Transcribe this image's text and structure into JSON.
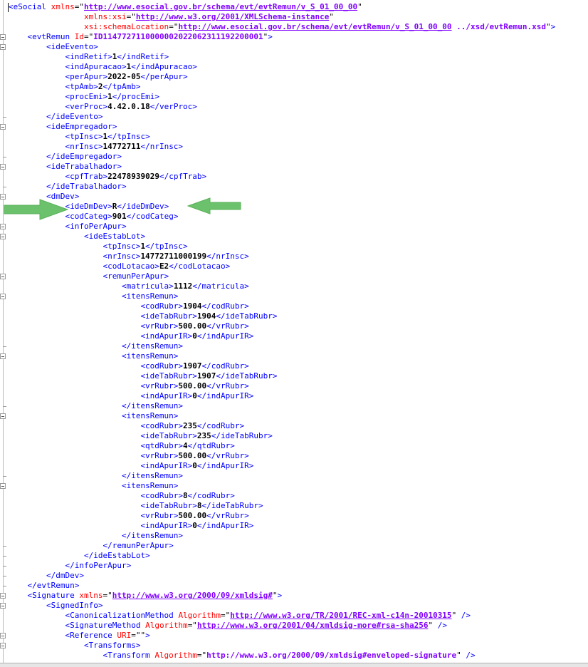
{
  "lines": [
    {
      "indent": 0,
      "parts": [
        [
          "tag",
          "<eSocial "
        ],
        [
          "attr",
          "xmlns"
        ],
        [
          "q",
          "=\""
        ],
        [
          "val",
          "http://www.esocial.gov.br/schema/evt/evtRemun/v_S_01_00_00"
        ],
        [
          "q",
          "\""
        ]
      ]
    },
    {
      "indent": 4,
      "parts": [
        [
          "attr",
          "xmlns:xsi"
        ],
        [
          "q",
          "=\""
        ],
        [
          "val",
          "http://www.w3.org/2001/XMLSchema-instance"
        ],
        [
          "q",
          "\""
        ]
      ]
    },
    {
      "indent": 4,
      "parts": [
        [
          "attr",
          "xsi:schemaLocation"
        ],
        [
          "q",
          "=\""
        ],
        [
          "val",
          "http://www.esocial.gov.br/schema/evt/evtRemun/v_S_01_00_00"
        ],
        [
          "valplain",
          " ../xsd/evtRemun.xsd"
        ],
        [
          "q",
          "\""
        ],
        [
          "tag",
          ">"
        ]
      ]
    },
    {
      "indent": 1,
      "parts": [
        [
          "tag",
          "<evtRemun "
        ],
        [
          "attr",
          "Id"
        ],
        [
          "q",
          "=\""
        ],
        [
          "valplain",
          "ID1147727110000002022062311192200001"
        ],
        [
          "q",
          "\""
        ],
        [
          "tag",
          ">"
        ]
      ]
    },
    {
      "indent": 2,
      "parts": [
        [
          "tag",
          "<ideEvento>"
        ]
      ]
    },
    {
      "indent": 3,
      "parts": [
        [
          "tag",
          "<indRetif>"
        ],
        [
          "txt",
          "1"
        ],
        [
          "tag",
          "</indRetif>"
        ]
      ]
    },
    {
      "indent": 3,
      "parts": [
        [
          "tag",
          "<indApuracao>"
        ],
        [
          "txt",
          "1"
        ],
        [
          "tag",
          "</indApuracao>"
        ]
      ]
    },
    {
      "indent": 3,
      "parts": [
        [
          "tag",
          "<perApur>"
        ],
        [
          "txt",
          "2022-05"
        ],
        [
          "tag",
          "</perApur>"
        ]
      ]
    },
    {
      "indent": 3,
      "parts": [
        [
          "tag",
          "<tpAmb>"
        ],
        [
          "txt",
          "2"
        ],
        [
          "tag",
          "</tpAmb>"
        ]
      ]
    },
    {
      "indent": 3,
      "parts": [
        [
          "tag",
          "<procEmi>"
        ],
        [
          "txt",
          "1"
        ],
        [
          "tag",
          "</procEmi>"
        ]
      ]
    },
    {
      "indent": 3,
      "parts": [
        [
          "tag",
          "<verProc>"
        ],
        [
          "txt",
          "4.42.0.18"
        ],
        [
          "tag",
          "</verProc>"
        ]
      ]
    },
    {
      "indent": 2,
      "parts": [
        [
          "tag",
          "</ideEvento>"
        ]
      ]
    },
    {
      "indent": 2,
      "parts": [
        [
          "tag",
          "<ideEmpregador>"
        ]
      ]
    },
    {
      "indent": 3,
      "parts": [
        [
          "tag",
          "<tpInsc>"
        ],
        [
          "txt",
          "1"
        ],
        [
          "tag",
          "</tpInsc>"
        ]
      ]
    },
    {
      "indent": 3,
      "parts": [
        [
          "tag",
          "<nrInsc>"
        ],
        [
          "txt",
          "14772711"
        ],
        [
          "tag",
          "</nrInsc>"
        ]
      ]
    },
    {
      "indent": 2,
      "parts": [
        [
          "tag",
          "</ideEmpregador>"
        ]
      ]
    },
    {
      "indent": 2,
      "parts": [
        [
          "tag",
          "<ideTrabalhador>"
        ]
      ]
    },
    {
      "indent": 3,
      "parts": [
        [
          "tag",
          "<cpfTrab>"
        ],
        [
          "txt",
          "22478939029"
        ],
        [
          "tag",
          "</cpfTrab>"
        ]
      ]
    },
    {
      "indent": 2,
      "parts": [
        [
          "tag",
          "</ideTrabalhador>"
        ]
      ]
    },
    {
      "indent": 2,
      "parts": [
        [
          "tag",
          "<dmDev>"
        ]
      ]
    },
    {
      "indent": 3,
      "parts": [
        [
          "tag",
          "<ideDmDev>"
        ],
        [
          "txt",
          "R"
        ],
        [
          "tag",
          "</ideDmDev>"
        ]
      ]
    },
    {
      "indent": 3,
      "parts": [
        [
          "tag",
          "<codCateg>"
        ],
        [
          "txt",
          "901"
        ],
        [
          "tag",
          "</codCateg>"
        ]
      ]
    },
    {
      "indent": 3,
      "parts": [
        [
          "tag",
          "<infoPerApur>"
        ]
      ]
    },
    {
      "indent": 4,
      "parts": [
        [
          "tag",
          "<ideEstabLot>"
        ]
      ]
    },
    {
      "indent": 5,
      "parts": [
        [
          "tag",
          "<tpInsc>"
        ],
        [
          "txt",
          "1"
        ],
        [
          "tag",
          "</tpInsc>"
        ]
      ]
    },
    {
      "indent": 5,
      "parts": [
        [
          "tag",
          "<nrInsc>"
        ],
        [
          "txt",
          "14772711000199"
        ],
        [
          "tag",
          "</nrInsc>"
        ]
      ]
    },
    {
      "indent": 5,
      "parts": [
        [
          "tag",
          "<codLotacao>"
        ],
        [
          "txt",
          "E2"
        ],
        [
          "tag",
          "</codLotacao>"
        ]
      ]
    },
    {
      "indent": 5,
      "parts": [
        [
          "tag",
          "<remunPerApur>"
        ]
      ]
    },
    {
      "indent": 6,
      "parts": [
        [
          "tag",
          "<matricula>"
        ],
        [
          "txt",
          "1112"
        ],
        [
          "tag",
          "</matricula>"
        ]
      ]
    },
    {
      "indent": 6,
      "parts": [
        [
          "tag",
          "<itensRemun>"
        ]
      ]
    },
    {
      "indent": 7,
      "parts": [
        [
          "tag",
          "<codRubr>"
        ],
        [
          "txt",
          "1904"
        ],
        [
          "tag",
          "</codRubr>"
        ]
      ]
    },
    {
      "indent": 7,
      "parts": [
        [
          "tag",
          "<ideTabRubr>"
        ],
        [
          "txt",
          "1904"
        ],
        [
          "tag",
          "</ideTabRubr>"
        ]
      ]
    },
    {
      "indent": 7,
      "parts": [
        [
          "tag",
          "<vrRubr>"
        ],
        [
          "txt",
          "500.00"
        ],
        [
          "tag",
          "</vrRubr>"
        ]
      ]
    },
    {
      "indent": 7,
      "parts": [
        [
          "tag",
          "<indApurIR>"
        ],
        [
          "txt",
          "0"
        ],
        [
          "tag",
          "</indApurIR>"
        ]
      ]
    },
    {
      "indent": 6,
      "parts": [
        [
          "tag",
          "</itensRemun>"
        ]
      ]
    },
    {
      "indent": 6,
      "parts": [
        [
          "tag",
          "<itensRemun>"
        ]
      ]
    },
    {
      "indent": 7,
      "parts": [
        [
          "tag",
          "<codRubr>"
        ],
        [
          "txt",
          "1907"
        ],
        [
          "tag",
          "</codRubr>"
        ]
      ]
    },
    {
      "indent": 7,
      "parts": [
        [
          "tag",
          "<ideTabRubr>"
        ],
        [
          "txt",
          "1907"
        ],
        [
          "tag",
          "</ideTabRubr>"
        ]
      ]
    },
    {
      "indent": 7,
      "parts": [
        [
          "tag",
          "<vrRubr>"
        ],
        [
          "txt",
          "500.00"
        ],
        [
          "tag",
          "</vrRubr>"
        ]
      ]
    },
    {
      "indent": 7,
      "parts": [
        [
          "tag",
          "<indApurIR>"
        ],
        [
          "txt",
          "0"
        ],
        [
          "tag",
          "</indApurIR>"
        ]
      ]
    },
    {
      "indent": 6,
      "parts": [
        [
          "tag",
          "</itensRemun>"
        ]
      ]
    },
    {
      "indent": 6,
      "parts": [
        [
          "tag",
          "<itensRemun>"
        ]
      ]
    },
    {
      "indent": 7,
      "parts": [
        [
          "tag",
          "<codRubr>"
        ],
        [
          "txt",
          "235"
        ],
        [
          "tag",
          "</codRubr>"
        ]
      ]
    },
    {
      "indent": 7,
      "parts": [
        [
          "tag",
          "<ideTabRubr>"
        ],
        [
          "txt",
          "235"
        ],
        [
          "tag",
          "</ideTabRubr>"
        ]
      ]
    },
    {
      "indent": 7,
      "parts": [
        [
          "tag",
          "<qtdRubr>"
        ],
        [
          "txt",
          "4"
        ],
        [
          "tag",
          "</qtdRubr>"
        ]
      ]
    },
    {
      "indent": 7,
      "parts": [
        [
          "tag",
          "<vrRubr>"
        ],
        [
          "txt",
          "500.00"
        ],
        [
          "tag",
          "</vrRubr>"
        ]
      ]
    },
    {
      "indent": 7,
      "parts": [
        [
          "tag",
          "<indApurIR>"
        ],
        [
          "txt",
          "0"
        ],
        [
          "tag",
          "</indApurIR>"
        ]
      ]
    },
    {
      "indent": 6,
      "parts": [
        [
          "tag",
          "</itensRemun>"
        ]
      ]
    },
    {
      "indent": 6,
      "parts": [
        [
          "tag",
          "<itensRemun>"
        ]
      ]
    },
    {
      "indent": 7,
      "parts": [
        [
          "tag",
          "<codRubr>"
        ],
        [
          "txt",
          "8"
        ],
        [
          "tag",
          "</codRubr>"
        ]
      ]
    },
    {
      "indent": 7,
      "parts": [
        [
          "tag",
          "<ideTabRubr>"
        ],
        [
          "txt",
          "8"
        ],
        [
          "tag",
          "</ideTabRubr>"
        ]
      ]
    },
    {
      "indent": 7,
      "parts": [
        [
          "tag",
          "<vrRubr>"
        ],
        [
          "txt",
          "500.00"
        ],
        [
          "tag",
          "</vrRubr>"
        ]
      ]
    },
    {
      "indent": 7,
      "parts": [
        [
          "tag",
          "<indApurIR>"
        ],
        [
          "txt",
          "0"
        ],
        [
          "tag",
          "</indApurIR>"
        ]
      ]
    },
    {
      "indent": 6,
      "parts": [
        [
          "tag",
          "</itensRemun>"
        ]
      ]
    },
    {
      "indent": 5,
      "parts": [
        [
          "tag",
          "</remunPerApur>"
        ]
      ]
    },
    {
      "indent": 4,
      "parts": [
        [
          "tag",
          "</ideEstabLot>"
        ]
      ]
    },
    {
      "indent": 3,
      "parts": [
        [
          "tag",
          "</infoPerApur>"
        ]
      ]
    },
    {
      "indent": 2,
      "parts": [
        [
          "tag",
          "</dmDev>"
        ]
      ]
    },
    {
      "indent": 1,
      "parts": [
        [
          "tag",
          "</evtRemun>"
        ]
      ]
    },
    {
      "indent": 1,
      "parts": [
        [
          "tag",
          "<Signature "
        ],
        [
          "attr",
          "xmlns"
        ],
        [
          "q",
          "=\""
        ],
        [
          "val",
          "http://www.w3.org/2000/09/xmldsig#"
        ],
        [
          "q",
          "\""
        ],
        [
          "tag",
          ">"
        ]
      ]
    },
    {
      "indent": 2,
      "parts": [
        [
          "tag",
          "<SignedInfo>"
        ]
      ]
    },
    {
      "indent": 3,
      "parts": [
        [
          "tag",
          "<CanonicalizationMethod "
        ],
        [
          "attr",
          "Algorithm"
        ],
        [
          "q",
          "=\""
        ],
        [
          "val",
          "http://www.w3.org/TR/2001/REC-xml-c14n-20010315"
        ],
        [
          "q",
          "\""
        ],
        [
          "tag",
          " />"
        ]
      ]
    },
    {
      "indent": 3,
      "parts": [
        [
          "tag",
          "<SignatureMethod "
        ],
        [
          "attr",
          "Algorithm"
        ],
        [
          "q",
          "=\""
        ],
        [
          "val",
          "http://www.w3.org/2001/04/xmldsig-more#rsa-sha256"
        ],
        [
          "q",
          "\""
        ],
        [
          "tag",
          " />"
        ]
      ]
    },
    {
      "indent": 3,
      "parts": [
        [
          "tag",
          "<Reference "
        ],
        [
          "attr",
          "URI"
        ],
        [
          "q",
          "=\"\""
        ],
        [
          "tag",
          ">"
        ]
      ]
    },
    {
      "indent": 4,
      "parts": [
        [
          "tag",
          "<Transforms>"
        ]
      ]
    },
    {
      "indent": 5,
      "parts": [
        [
          "tag",
          "<Transform "
        ],
        [
          "attr",
          "Algorithm"
        ],
        [
          "q",
          "=\""
        ],
        [
          "valplain",
          "http://www.w3.org/2000/09/xmldsig#enveloped-signature"
        ],
        [
          "q",
          "\""
        ],
        [
          "tag",
          " />"
        ]
      ]
    }
  ],
  "fold_open_lines": [
    3,
    4,
    12,
    16,
    19,
    22,
    23,
    27,
    29,
    35,
    41,
    48,
    59,
    60,
    63,
    64
  ],
  "fold_close_lines": [
    11,
    15,
    18,
    34,
    40,
    47,
    54,
    55,
    56,
    57,
    58
  ],
  "highlight_line": 20,
  "colors": {
    "tag": "#0000ff",
    "attr": "#ff0000",
    "value": "#8000ff",
    "text": "#000000",
    "arrow": "#6cc26c"
  }
}
